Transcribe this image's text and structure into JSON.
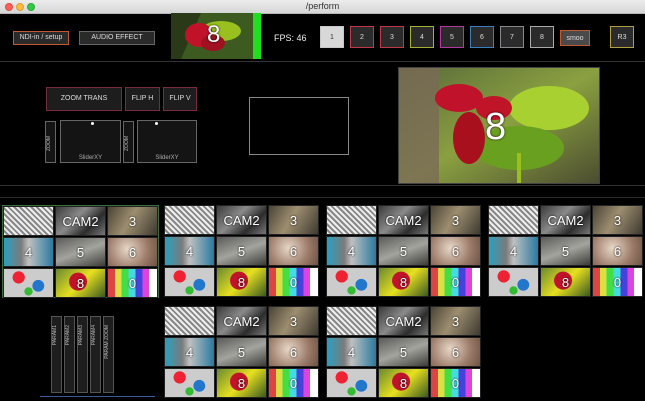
{
  "window": {
    "title": "/perform"
  },
  "toolbar": {
    "ndi_label": "NDI-in / setup",
    "audio_label": "AUDIO EFFECT",
    "preview_number": "8",
    "fps_label": "FPS: 46",
    "selectors": [
      {
        "label": "1",
        "color": "#c7c7c7"
      },
      {
        "label": "2",
        "color": "#c0394b"
      },
      {
        "label": "3",
        "color": "#c0394b"
      },
      {
        "label": "4",
        "color": "#a3b235"
      },
      {
        "label": "5",
        "color": "#b03aa0"
      },
      {
        "label": "6",
        "color": "#3a80c0"
      },
      {
        "label": "7",
        "color": "#888888"
      },
      {
        "label": "8",
        "color": "#aaaaaa"
      }
    ],
    "smoo_label": "smoo",
    "r3_label": "R3"
  },
  "controls": {
    "zoom_trans": "ZOOM TRANS",
    "flip_h": "FLIP H",
    "flip_v": "FLIP V",
    "zoom_label": "ZOOM",
    "slider_xy": "SliderXY"
  },
  "main_preview": {
    "number": "8"
  },
  "grid": {
    "cells": [
      {
        "label": "",
        "cls": "c1"
      },
      {
        "label": "CAM2",
        "cls": "c2"
      },
      {
        "label": "3",
        "cls": "c3"
      },
      {
        "label": "4",
        "cls": "c4"
      },
      {
        "label": "5",
        "cls": "c5"
      },
      {
        "label": "6",
        "cls": "c6"
      },
      {
        "label": "",
        "cls": "c7"
      },
      {
        "label": "8",
        "cls": "c8"
      },
      {
        "label": "0",
        "cls": "c9"
      }
    ]
  },
  "faders": [
    "PARAM1",
    "PARAM2",
    "PARAM3",
    "PARAM4",
    "PARAM ZOOM"
  ]
}
